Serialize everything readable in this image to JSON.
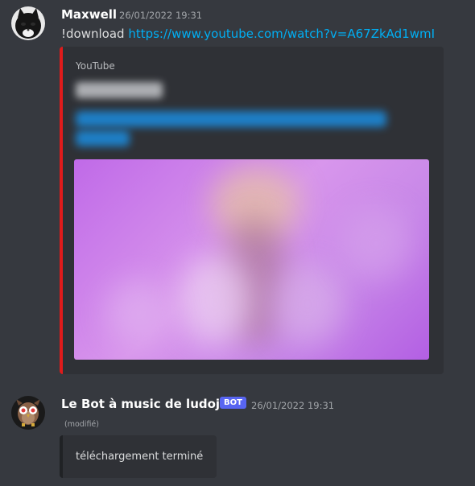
{
  "colors": {
    "background": "#36393f",
    "embed_bg": "#2f3136",
    "embed_accent": "#e01b1b",
    "link": "#00aff4",
    "bot_tag": "#5865f2",
    "thumbnail": "#c06ae8"
  },
  "messages": [
    {
      "username": "Maxwell",
      "timestamp": "26/01/2022 19:31",
      "avatar_icon": "black-cat-avatar",
      "text": "!download ",
      "link": "https://www.youtube.com/watch?v=A67ZkAd1wmI",
      "embed": {
        "provider": "YouTube",
        "thumbnail_icon": "video-thumbnail"
      }
    },
    {
      "username": "Le Bot à music de ludojeu",
      "badge": "BOT",
      "timestamp": "26/01/2022 19:31",
      "avatar_icon": "owl-avatar",
      "edited": "(modifié)",
      "text": "téléchargement terminé"
    }
  ]
}
